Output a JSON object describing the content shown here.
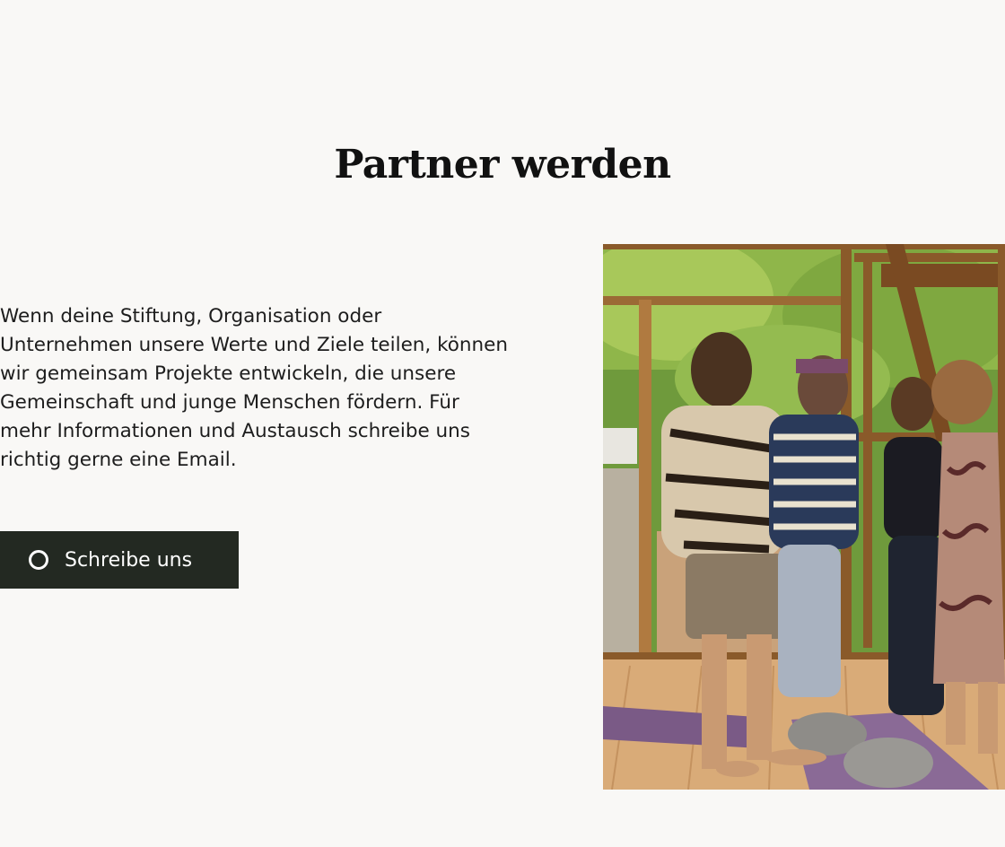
{
  "section": {
    "title": "Partner werden",
    "body": "Wenn deine Stiftung, Organisation oder Unternehmen unsere Werte und Ziele teilen, können wir gemeinsam Projekte entwickeln, die unsere Gemeinschaft und junge Menschen fördern. Für mehr Informationen und Austausch schreibe uns richtig gerne eine Email.",
    "cta_label": "Schreibe uns",
    "cta_icon": "circle-icon"
  },
  "colors": {
    "background": "#f9f8f6",
    "button": "#232922",
    "button_text": "#ffffff",
    "text": "#1d1d1d"
  }
}
